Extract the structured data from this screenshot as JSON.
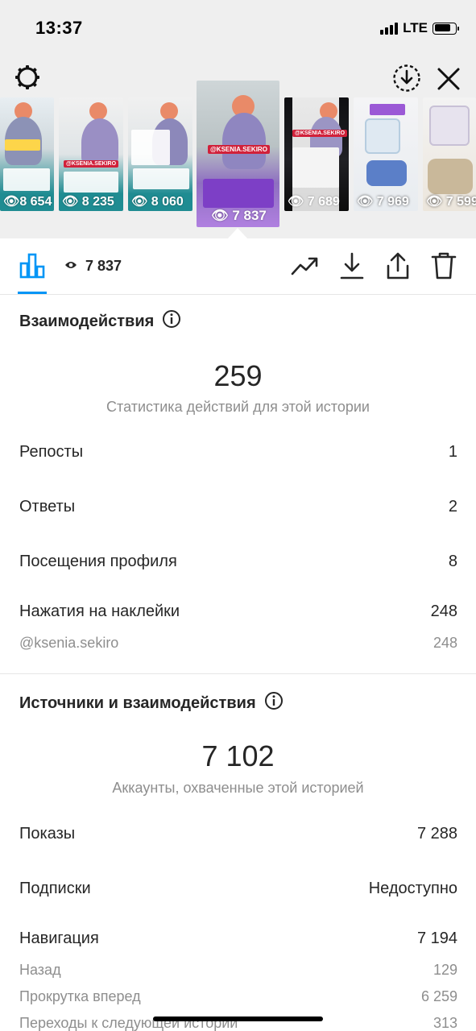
{
  "status_bar": {
    "time": "13:37",
    "network": "LTE"
  },
  "stories": [
    {
      "views": "8 654"
    },
    {
      "views": "8 235"
    },
    {
      "views": "8 060"
    },
    {
      "views": "7 837",
      "selected": true,
      "tag": "@KSENIA.SEKIRO"
    },
    {
      "views": "7 689"
    },
    {
      "views": "7 969"
    },
    {
      "views": "7 599"
    }
  ],
  "toolbar": {
    "views_count": "7 837"
  },
  "interactions": {
    "title": "Взаимодействия",
    "total": "259",
    "subtitle": "Статистика действий для этой истории",
    "rows": [
      {
        "label": "Репосты",
        "value": "1"
      },
      {
        "label": "Ответы",
        "value": "2"
      },
      {
        "label": "Посещения профиля",
        "value": "8"
      },
      {
        "label": "Нажатия на наклейки",
        "value": "248"
      }
    ],
    "sticker_sub": {
      "label": "@ksenia.sekiro",
      "value": "248"
    }
  },
  "discovery": {
    "title": "Источники и взаимодействия",
    "total": "7 102",
    "subtitle": "Аккаунты, охваченные этой историей",
    "rows": [
      {
        "label": "Показы",
        "value": "7 288"
      },
      {
        "label": "Подписки",
        "value": "Недоступно"
      },
      {
        "label": "Навигация",
        "value": "7 194"
      }
    ],
    "navigation_sub": [
      {
        "label": "Назад",
        "value": "129"
      },
      {
        "label": "Прокрутка вперед",
        "value": "6 259"
      },
      {
        "label": "Переходы к следующей истории",
        "value": "313"
      }
    ]
  },
  "colors": {
    "accent": "#0095f6",
    "thumb_teal": "#1f8c92",
    "sticker_purple": "#9b59d6"
  }
}
